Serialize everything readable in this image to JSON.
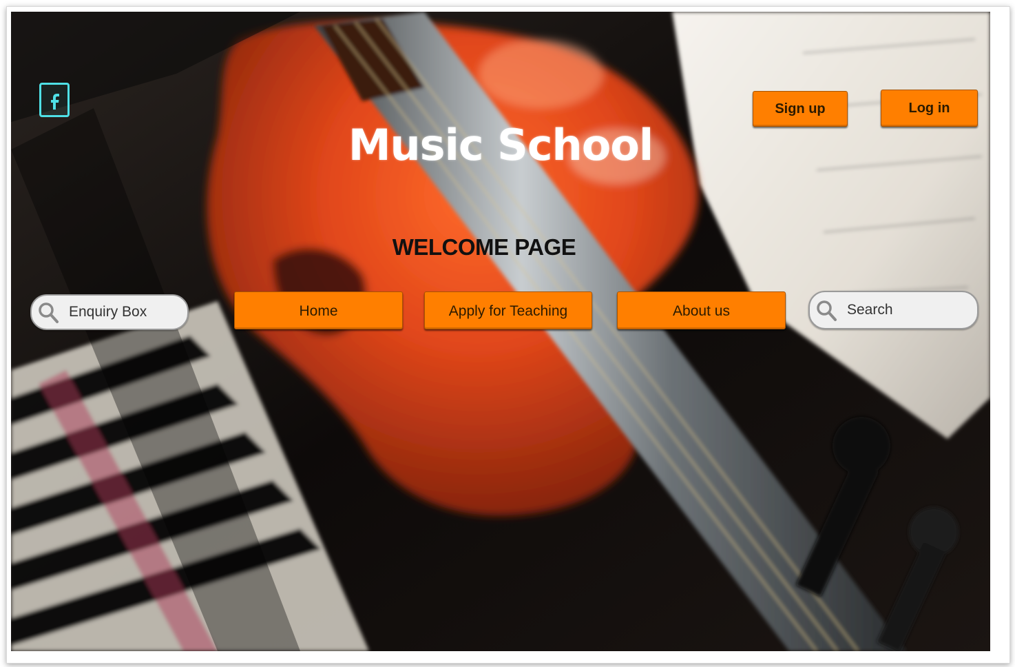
{
  "header": {
    "site_title": "Music School",
    "welcome_heading": "WELCOME PAGE"
  },
  "auth": {
    "signup_label": "Sign up",
    "login_label": "Log in"
  },
  "nav": {
    "items": [
      {
        "label": "Home"
      },
      {
        "label": "Apply for Teaching"
      },
      {
        "label": "About us"
      }
    ]
  },
  "enquiry": {
    "placeholder": "Enquiry Box"
  },
  "search": {
    "placeholder": "Search"
  },
  "icons": {
    "social": "facebook-icon",
    "search": "magnifier-icon"
  },
  "colors": {
    "accent": "#ff7f00",
    "facebook_outline": "#4fe0e6",
    "title": "#ffffff"
  }
}
